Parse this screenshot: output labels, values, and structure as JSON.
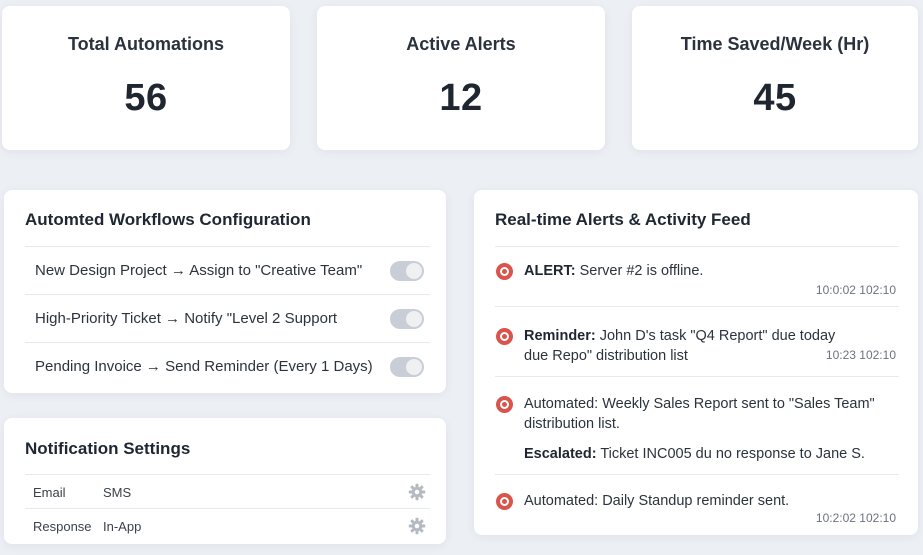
{
  "stats": [
    {
      "label": "Total Automations",
      "value": "56"
    },
    {
      "label": "Active Alerts",
      "value": "12"
    },
    {
      "label": "Time Saved/Week (Hr)",
      "value": "45"
    }
  ],
  "workflows": {
    "title": "Automted Workflows Configuration",
    "items": [
      {
        "label": "New Design Project → Assign to \"Creative Team\"",
        "enabled": true
      },
      {
        "label": "High-Priority Ticket → Notify \"Level 2 Support",
        "enabled": true
      },
      {
        "label": "Pending Invoice → Send Reminder (Every 1 Days)",
        "enabled": true
      }
    ]
  },
  "notifications": {
    "title": "Notification Settings",
    "rows": [
      {
        "type": "Email",
        "value": "SMS",
        "icon": "gear-icon"
      },
      {
        "type": "Response",
        "value": "In-App",
        "icon": "gear-icon"
      }
    ]
  },
  "feed": {
    "title": "Real-time Alerts & Activity Feed",
    "items": [
      {
        "prefix": "ALERT:",
        "line1": " Server #2 is offline.",
        "line2": "",
        "time": "10:0:02 102:10"
      },
      {
        "prefix": "Reminder:",
        "line1": " John D's task \"Q4 Report\" due today",
        "line2": "due Repo\" distribution list",
        "time": "10:23 102:10"
      },
      {
        "prefix": "Automated:",
        "line1": " Weekly Sales Report sent to \"Sales Team\"",
        "line2": "distribution list.",
        "time": ""
      },
      {
        "prefix": "Escalated:",
        "line1": " Ticket INC005 du no response to Jane S.",
        "line2": "",
        "time": ""
      },
      {
        "prefix": "Automated:",
        "line1": " Daily Standup reminder sent.",
        "line2": "",
        "time": "10:2:02 102:10"
      }
    ]
  },
  "colors": {
    "background": "#eceff4",
    "card": "#ffffff",
    "alert_icon": "#d9544a",
    "toggle": "#c9ced6"
  }
}
